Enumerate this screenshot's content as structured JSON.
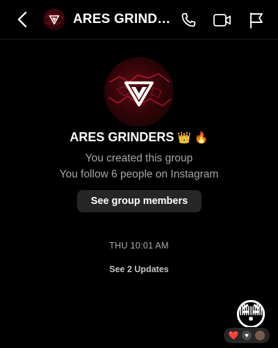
{
  "header": {
    "title": "ARES GRINDERS",
    "back_icon": "chevron-left-icon",
    "call_icon": "phone-icon",
    "video_icon": "video-camera-icon",
    "flag_icon": "flag-icon"
  },
  "profile": {
    "name": "ARES GRINDERS",
    "emojis": "👑 🔥",
    "created_text": "You created this group",
    "follow_text": "You follow 6 people on Instagram",
    "members_button": "See group members"
  },
  "chat": {
    "timestamp": "THU 10:01 AM",
    "updates_text": "See 2 Updates",
    "message_emoji": "😳",
    "reaction_heart": "❤️"
  },
  "colors": {
    "background": "#000000",
    "button_bg": "#262626",
    "secondary_text": "#a8a8a8",
    "accent_red": "#e0142a"
  }
}
